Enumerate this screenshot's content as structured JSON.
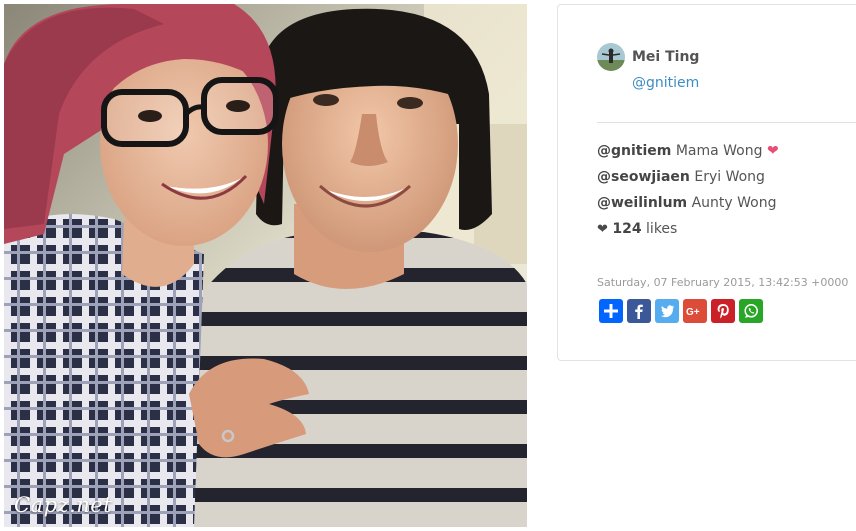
{
  "photo": {
    "watermark": "Capz.net"
  },
  "author": {
    "name": "Mei Ting",
    "handle": "@gnitiem",
    "avatar_icon": "avatar-photo"
  },
  "tags": [
    {
      "handle": "@gnitiem",
      "label": "Mama Wong",
      "icon": "heart-icon",
      "icon_color": "#e94e77"
    },
    {
      "handle": "@seowjiaen",
      "label": "Eryi Wong"
    },
    {
      "handle": "@weilinlum",
      "label": "Aunty Wong"
    }
  ],
  "likes": {
    "icon": "heart-icon",
    "count": "124",
    "label": "likes"
  },
  "timestamp": "Saturday, 07 February 2015, 13:42:53 +0000",
  "share_buttons": [
    {
      "name": "share-plus",
      "icon": "plus-icon",
      "color": "#0166ff"
    },
    {
      "name": "share-facebook",
      "icon": "facebook-icon",
      "color": "#3b5998"
    },
    {
      "name": "share-twitter",
      "icon": "twitter-icon",
      "color": "#55acee"
    },
    {
      "name": "share-google-plus",
      "icon": "google-plus-icon",
      "color": "#dd4b39"
    },
    {
      "name": "share-pinterest",
      "icon": "pinterest-icon",
      "color": "#cb2027"
    },
    {
      "name": "share-whatsapp",
      "icon": "whatsapp-icon",
      "color": "#29a628"
    }
  ],
  "colors": {
    "link": "#3d8dc3",
    "heart": "#e94e77",
    "card_border": "#e3e3e3"
  }
}
